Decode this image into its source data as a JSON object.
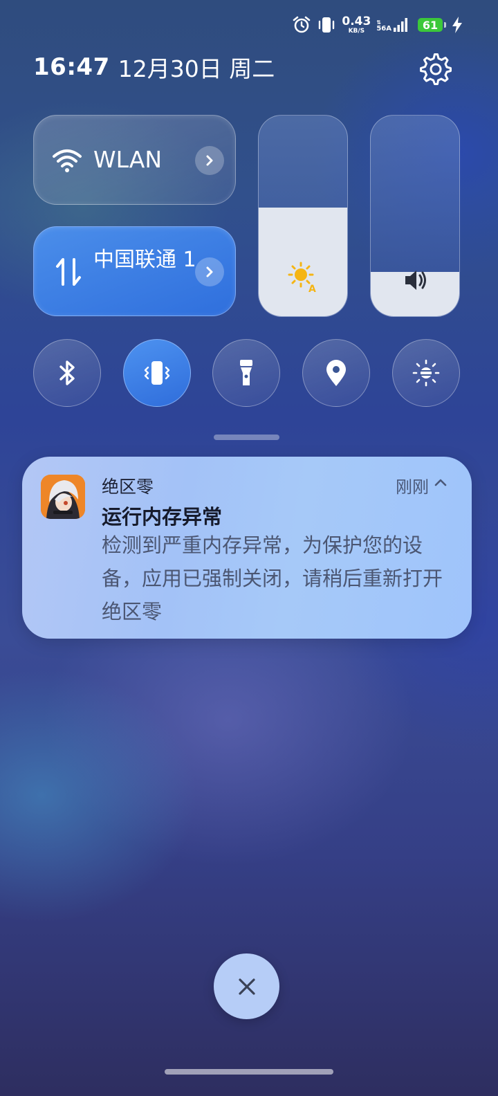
{
  "status_bar": {
    "icons": [
      "alarm-icon",
      "vibrate-icon",
      "signal-icon",
      "charging-icon"
    ],
    "net_speed_value": "0.43",
    "net_speed_unit": "KB/S",
    "network_type": "56A",
    "battery_level": "61",
    "battery_color": "#3cc83a"
  },
  "header": {
    "time": "16:47",
    "date": "12月30日 周二",
    "settings_icon": "gear-icon"
  },
  "tiles": {
    "wlan": {
      "label": "WLAN",
      "icon": "wifi-icon",
      "active": false
    },
    "cellular": {
      "label": "中国联通 1",
      "icon": "mobile-data-icon",
      "active": true
    }
  },
  "sliders": {
    "brightness": {
      "icon": "auto-brightness-icon",
      "level": 0.54
    },
    "volume": {
      "icon": "speaker-icon",
      "level": 0.22
    }
  },
  "toggles": [
    {
      "id": "bluetooth",
      "icon": "bluetooth-icon",
      "active": false
    },
    {
      "id": "vibrate",
      "icon": "vibrate-icon",
      "active": true
    },
    {
      "id": "flashlight",
      "icon": "flashlight-icon",
      "active": false
    },
    {
      "id": "location",
      "icon": "location-icon",
      "active": false
    },
    {
      "id": "eye-comfort",
      "icon": "eye-comfort-icon",
      "active": false
    }
  ],
  "notification": {
    "app_name": "绝区零",
    "time": "刚刚",
    "title": "运行内存异常",
    "body": "检测到严重内存异常，为保护您的设备，应用已强制关闭，请稍后重新打开绝区零"
  },
  "accent_color": "#3b7ee6"
}
